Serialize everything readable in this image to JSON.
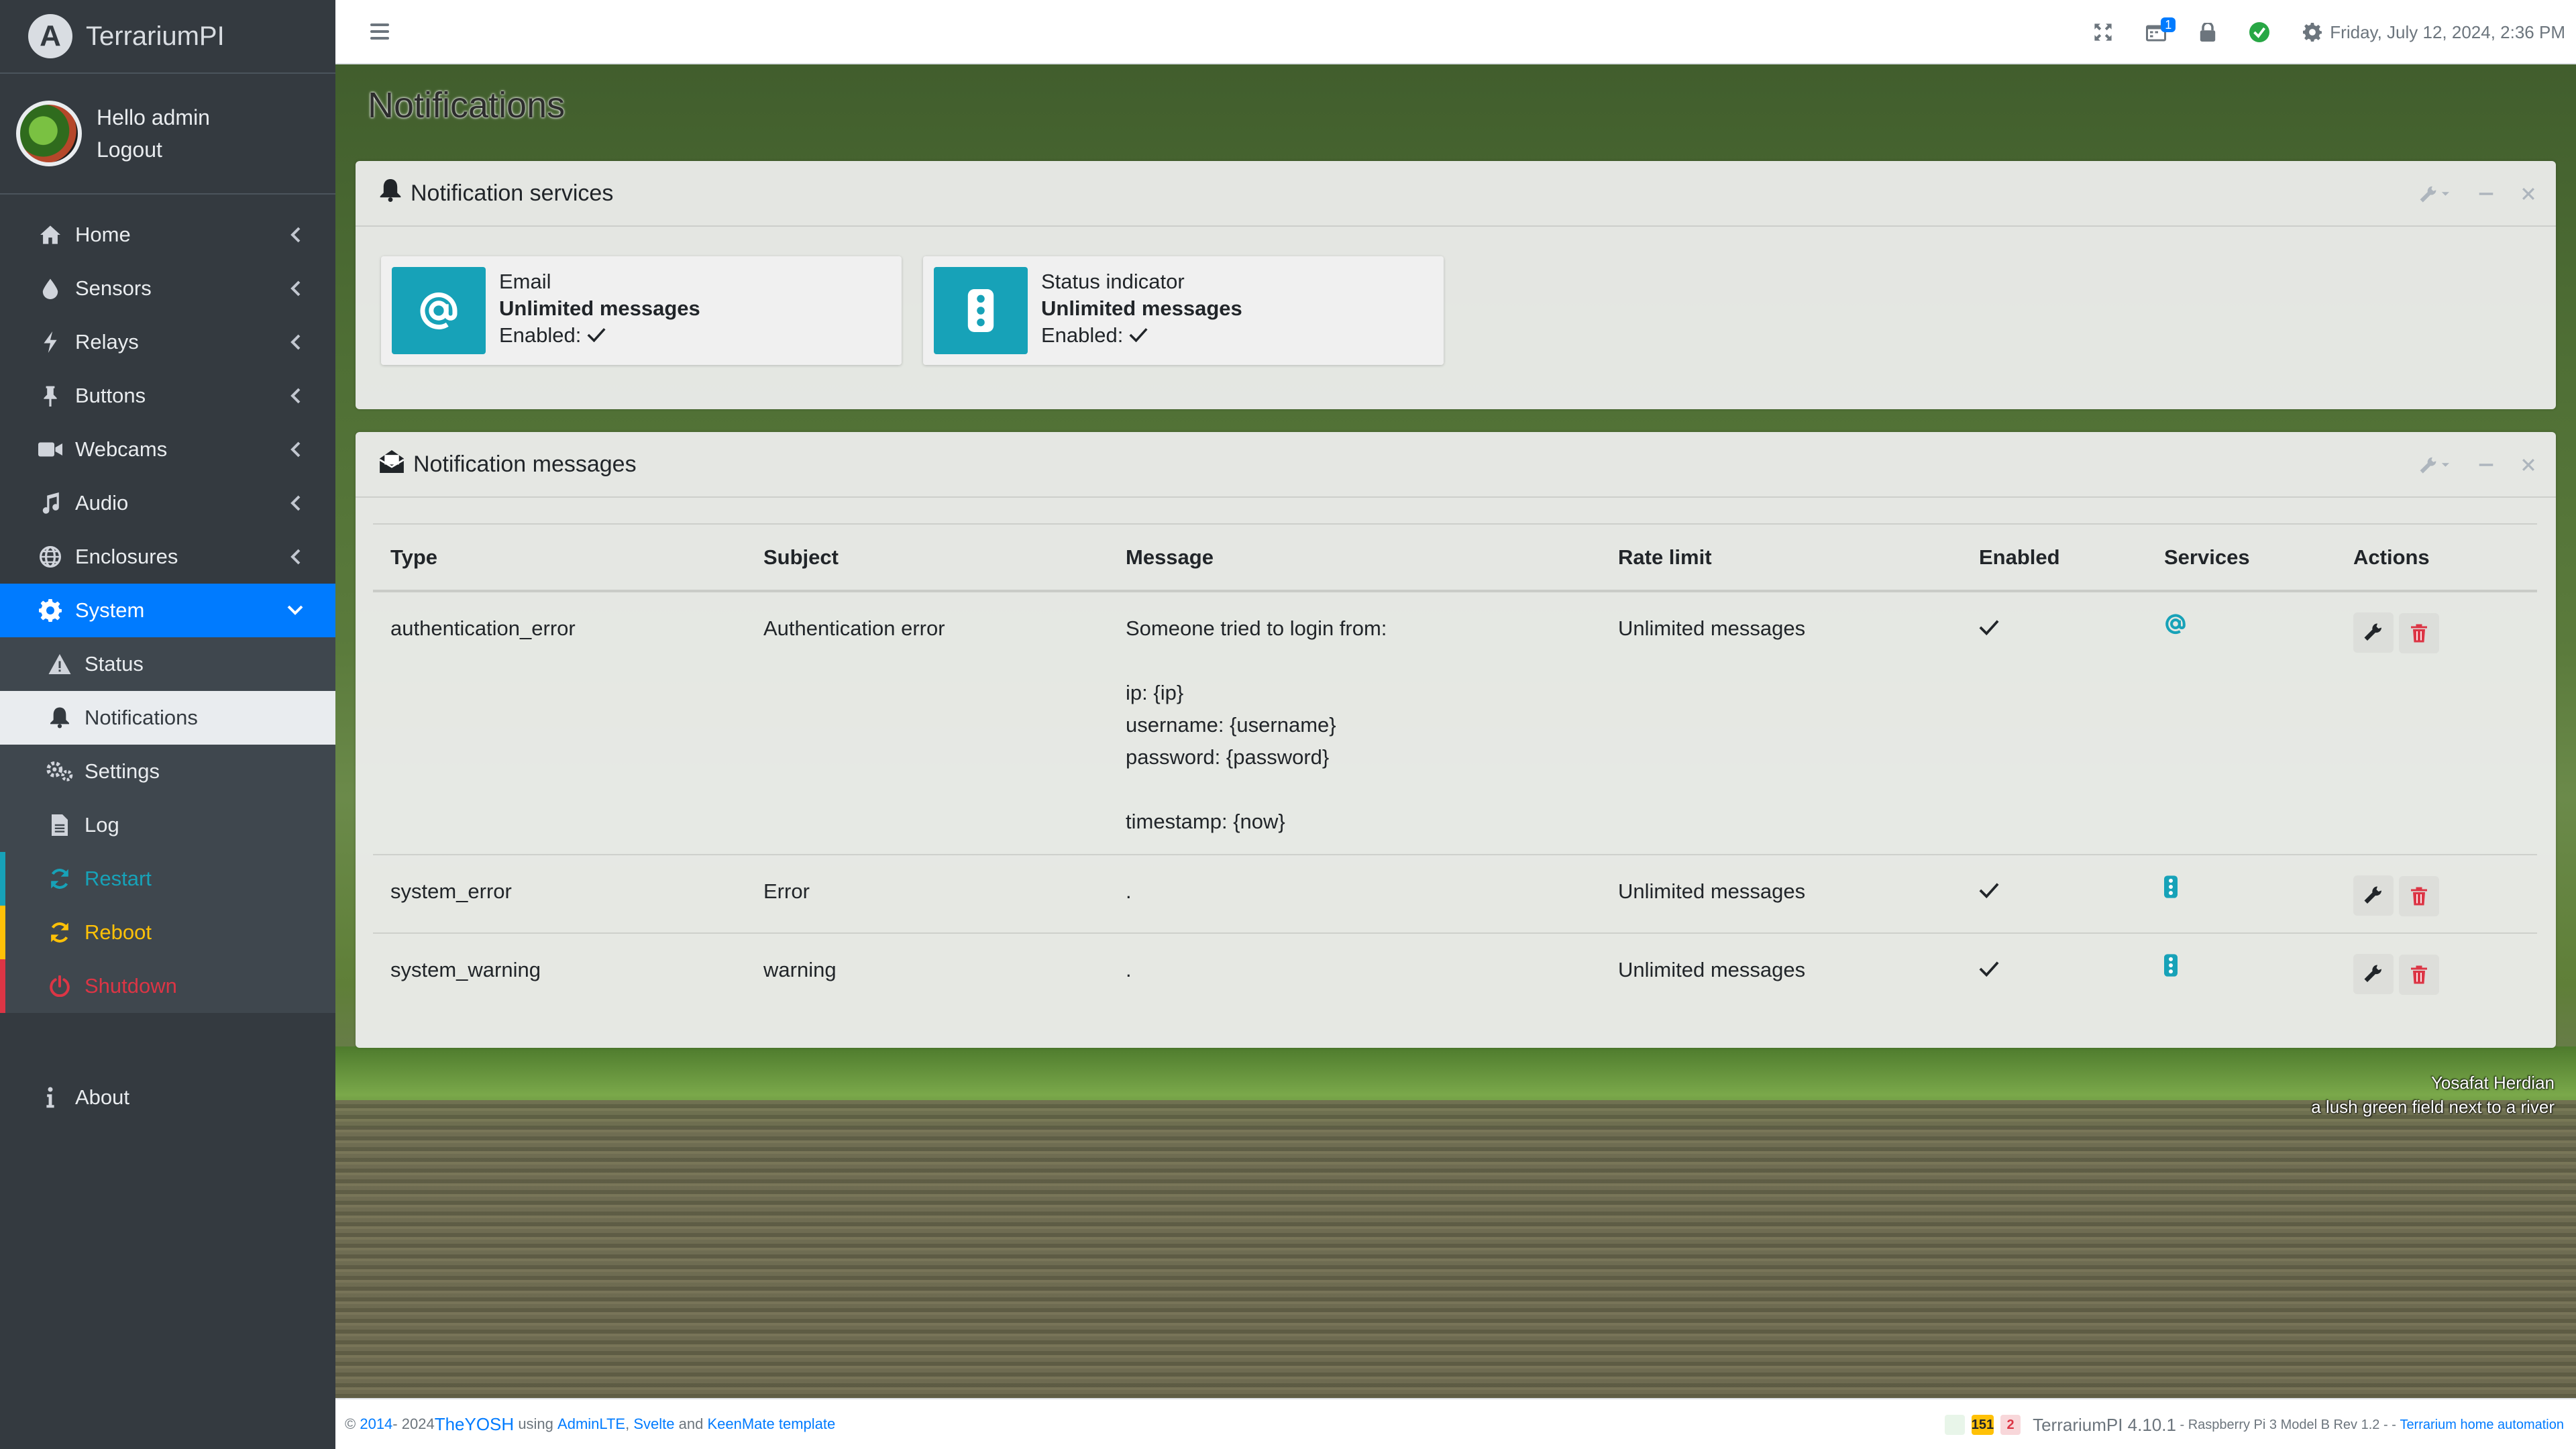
{
  "brand": {
    "name": "TerrariumPI",
    "logo": "A"
  },
  "user": {
    "greeting": "Hello admin",
    "logout": "Logout"
  },
  "sidebar": {
    "items": [
      {
        "label": "Home",
        "icon": "home-icon"
      },
      {
        "label": "Sensors",
        "icon": "droplet-icon"
      },
      {
        "label": "Relays",
        "icon": "bolt-icon"
      },
      {
        "label": "Buttons",
        "icon": "pushpin-icon"
      },
      {
        "label": "Webcams",
        "icon": "video-icon"
      },
      {
        "label": "Audio",
        "icon": "music-icon"
      },
      {
        "label": "Enclosures",
        "icon": "globe-icon"
      },
      {
        "label": "System",
        "icon": "gear-icon"
      }
    ],
    "system_sub": [
      {
        "label": "Status",
        "icon": "warning-icon"
      },
      {
        "label": "Notifications",
        "icon": "bell-icon"
      },
      {
        "label": "Settings",
        "icon": "gears-icon"
      },
      {
        "label": "Log",
        "icon": "file-icon"
      },
      {
        "label": "Restart",
        "icon": "sync-icon"
      },
      {
        "label": "Reboot",
        "icon": "sync-icon"
      },
      {
        "label": "Shutdown",
        "icon": "power-icon"
      }
    ],
    "about": "About"
  },
  "topbar": {
    "datetime": "Friday, July 12, 2024, 2:36 PM",
    "calendar_badge": "1",
    "colors": {
      "status_ok": "#28a745"
    }
  },
  "page": {
    "title": "Notifications"
  },
  "services_card": {
    "title": "Notification services",
    "services": [
      {
        "name": "Email",
        "limit": "Unlimited messages",
        "enabled_label": "Enabled:",
        "icon": "at-icon"
      },
      {
        "name": "Status indicator",
        "limit": "Unlimited messages",
        "enabled_label": "Enabled:",
        "icon": "traffic-light-icon"
      }
    ]
  },
  "messages_card": {
    "title": "Notification messages",
    "columns": [
      "Type",
      "Subject",
      "Message",
      "Rate limit",
      "Enabled",
      "Services",
      "Actions"
    ],
    "rows": [
      {
        "type": "authentication_error",
        "subject": "Authentication error",
        "message": [
          "Someone tried to login from:",
          "",
          "ip: {ip}",
          "username: {username}",
          "password: {password}",
          "",
          "timestamp: {now}"
        ],
        "rate_limit": "Unlimited messages",
        "service": "at-icon"
      },
      {
        "type": "system_error",
        "subject": "Error",
        "message": [
          "."
        ],
        "rate_limit": "Unlimited messages",
        "service": "traffic-light-icon"
      },
      {
        "type": "system_warning",
        "subject": "warning",
        "message": [
          "."
        ],
        "rate_limit": "Unlimited messages",
        "service": "traffic-light-icon"
      }
    ]
  },
  "credit": {
    "author": "Yosafat Herdian",
    "caption": "a lush green field next to a river"
  },
  "footer": {
    "copyright": "©",
    "year_start": "2014",
    "year_sep": " - 2024 ",
    "author": "TheYOSH",
    "using": "using",
    "adminlte": "AdminLTE",
    "svelte": "Svelte",
    "and": "and",
    "keenmate": "KeenMate template",
    "badge_yellow": "151",
    "badge_red": "2",
    "version": "TerrariumPI 4.10.1",
    "hardware": "- Raspberry Pi 3 Model B Rev 1.2 -",
    "dash": "-",
    "tagline": "Terrarium home automation"
  }
}
